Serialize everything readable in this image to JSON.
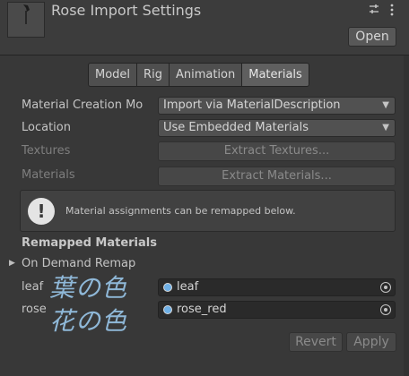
{
  "header": {
    "title": "Rose Import Settings",
    "open_label": "Open",
    "settings_icon": "sliders-icon",
    "menu_icon": "kebab-icon"
  },
  "tabs": [
    {
      "label": "Model",
      "active": false
    },
    {
      "label": "Rig",
      "active": false
    },
    {
      "label": "Animation",
      "active": false
    },
    {
      "label": "Materials",
      "active": true
    }
  ],
  "material_creation": {
    "label": "Material Creation Mo",
    "value": "Import via MaterialDescription"
  },
  "location": {
    "label": "Location",
    "value": "Use Embedded Materials"
  },
  "textures": {
    "label": "Textures",
    "button": "Extract Textures..."
  },
  "materials": {
    "label": "Materials",
    "button": "Extract Materials..."
  },
  "help": {
    "icon": "exclamation-icon",
    "text": "Material assignments can be remapped below."
  },
  "remapped": {
    "title": "Remapped Materials",
    "foldout_label": "On Demand Remap",
    "rows": [
      {
        "label": "leaf",
        "annotation": "葉の色",
        "value": "leaf"
      },
      {
        "label": "rose",
        "annotation": "花の色",
        "value": "rose_red"
      }
    ]
  },
  "footer": {
    "revert": "Revert",
    "apply": "Apply"
  },
  "colors": {
    "background": "#383838",
    "handwriting": "#8fb8d8",
    "object_icon": "#6fb0e6"
  }
}
